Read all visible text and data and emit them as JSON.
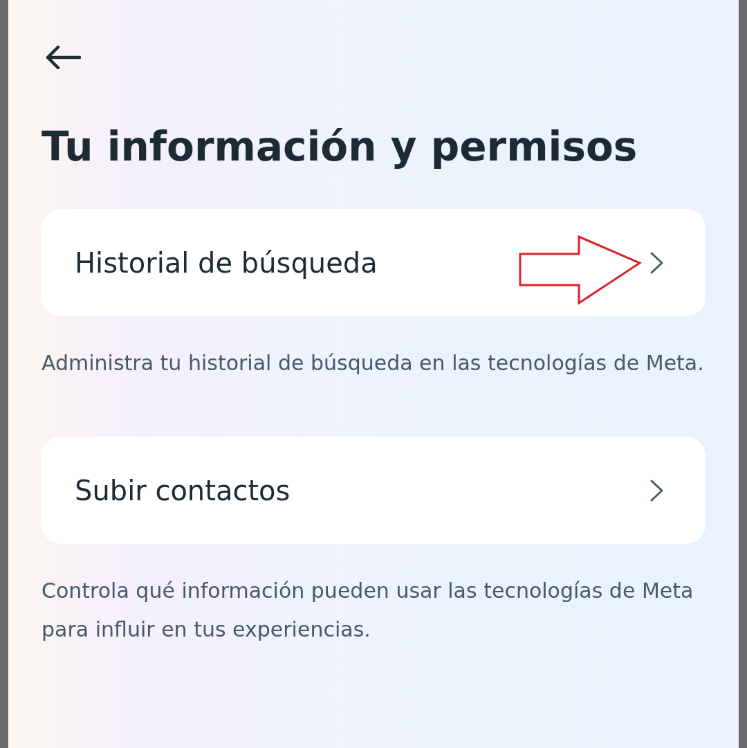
{
  "header": {
    "title": "Tu información y permisos"
  },
  "items": [
    {
      "label": "Historial de búsqueda",
      "description": "Administra tu historial de búsqueda en las tecnologías de Meta.",
      "highlighted": true
    },
    {
      "label": "Subir contactos",
      "description": "Controla qué información pueden usar las tecnologías de Meta para influir en tus experiencias.",
      "highlighted": false
    }
  ]
}
